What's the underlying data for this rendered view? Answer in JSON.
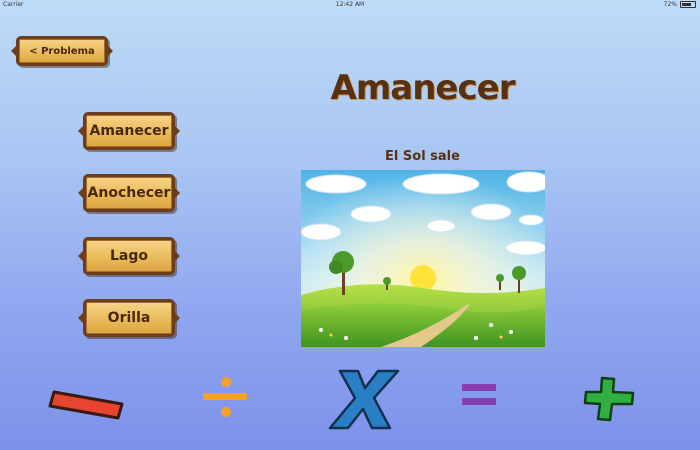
{
  "status_bar": {
    "carrier": "Carrier",
    "time": "12:42 AM",
    "battery": "72%"
  },
  "back_button": {
    "label": "< Problema"
  },
  "sidebar": {
    "items": [
      {
        "label": "Amanecer"
      },
      {
        "label": "Anochecer"
      },
      {
        "label": "Lago"
      },
      {
        "label": "Orilla"
      }
    ]
  },
  "main": {
    "title": "Amanecer",
    "subtitle": "El Sol sale",
    "image_icon": "sunrise-landscape-illustration"
  },
  "operators": [
    {
      "icon": "minus-icon",
      "color": "#e8452f"
    },
    {
      "icon": "divide-icon",
      "color": "#f4a22a"
    },
    {
      "icon": "times-icon",
      "color": "#2a7fc4"
    },
    {
      "icon": "equals-icon",
      "color": "#8a3fb0"
    },
    {
      "icon": "plus-icon",
      "color": "#2fb043"
    }
  ],
  "colors": {
    "wood": "#e9b957",
    "wood_border": "#6b3d1a",
    "title_text": "#5a3110"
  }
}
